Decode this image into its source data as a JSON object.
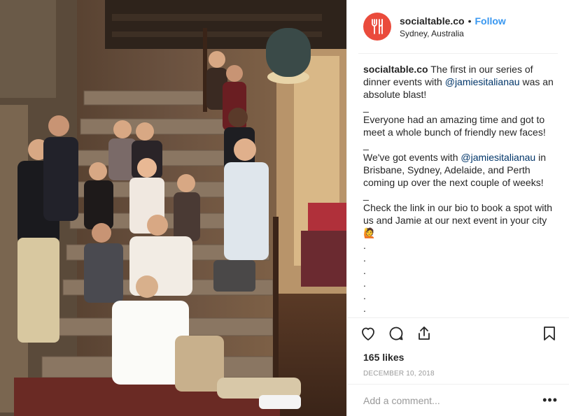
{
  "post": {
    "photo_alt": "",
    "header": {
      "username": "socialtable.co",
      "separator": "•",
      "follow_label": "Follow",
      "location": "Sydney, Australia"
    },
    "caption": {
      "username": "socialtable.co",
      "line1": "The first in our series of dinner events with",
      "mention1": "@jamiesitalianau",
      "line1_end": "was an absolute blast!",
      "sep1": "_",
      "para2": "Everyone had an amazing time and got to meet a whole bunch of friendly new faces!",
      "sep2": "_",
      "para3_start": "We've got events with",
      "mention2": "@jamiesitalianau",
      "para3_end": "in Brisbane, Sydney, Adelaide, and Perth coming up over the next couple of weeks!",
      "sep3": "_",
      "para4": "Check the link in our bio to book a spot with us and Jamie at our next event in your city",
      "emoji": "🙋",
      "dots": [
        ".",
        ".",
        ".",
        ".",
        ".",
        "."
      ]
    },
    "actions": {
      "like_icon": "heart-icon",
      "comment_icon": "comment-icon",
      "share_icon": "share-icon",
      "save_icon": "bookmark-icon"
    },
    "likes": "165 likes",
    "date": "DECEMBER 10, 2018",
    "comment_placeholder": "Add a comment...",
    "more_label": "•••",
    "colors": {
      "accent": "#3897f0",
      "avatar": "#ea4b3c",
      "muted": "#999999",
      "mention": "#003569"
    }
  }
}
